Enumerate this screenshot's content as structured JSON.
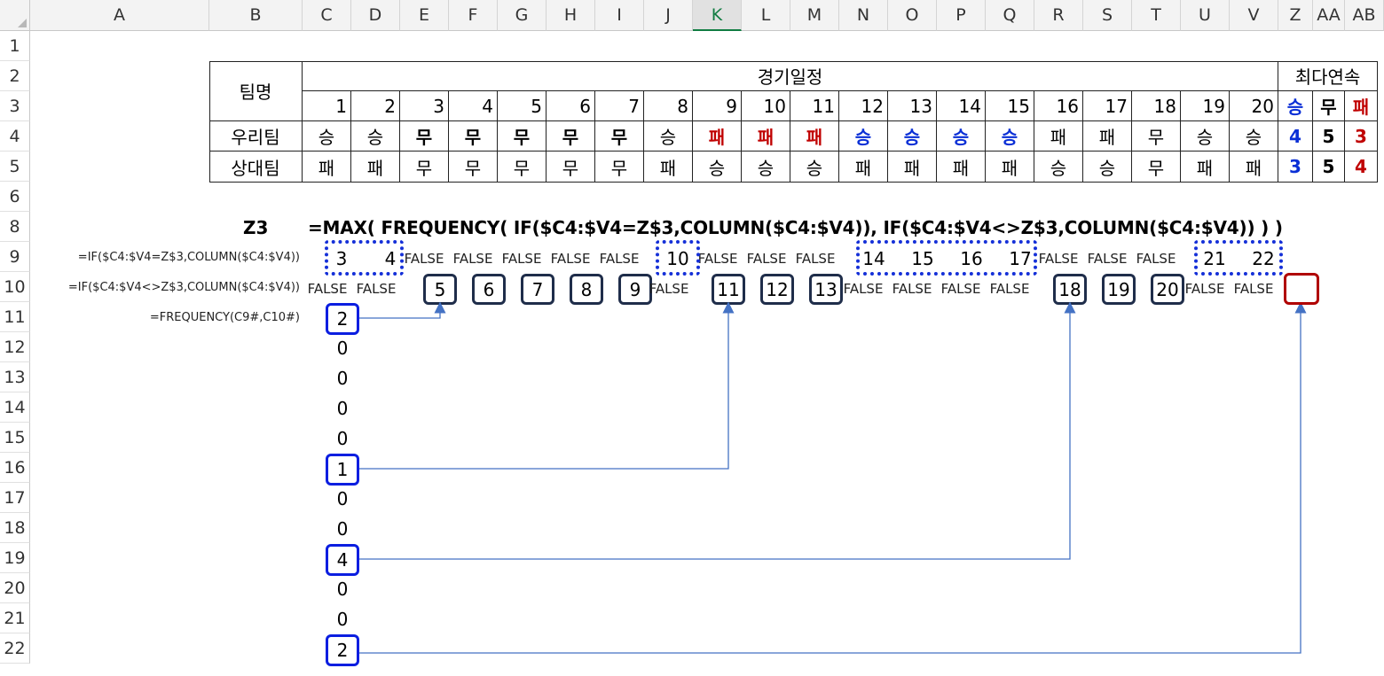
{
  "columns": [
    "A",
    "B",
    "C",
    "D",
    "E",
    "F",
    "G",
    "H",
    "I",
    "J",
    "K",
    "L",
    "M",
    "N",
    "O",
    "P",
    "Q",
    "R",
    "S",
    "T",
    "U",
    "V",
    "Z",
    "AA",
    "AB"
  ],
  "selected_column": "K",
  "rows": [
    "1",
    "2",
    "3",
    "4",
    "5",
    "6",
    "8",
    "9",
    "10",
    "11",
    "12",
    "13",
    "14",
    "15",
    "16",
    "17",
    "18",
    "19",
    "20",
    "21",
    "22"
  ],
  "table": {
    "team_header": "팀명",
    "schedule_header": "경기일정",
    "streak_header": "최다연속",
    "game_numbers": [
      "1",
      "2",
      "3",
      "4",
      "5",
      "6",
      "7",
      "8",
      "9",
      "10",
      "11",
      "12",
      "13",
      "14",
      "15",
      "16",
      "17",
      "18",
      "19",
      "20"
    ],
    "streak_labels": [
      "승",
      "무",
      "패"
    ],
    "our_team": "우리팀",
    "opp_team": "상대팀",
    "our_results": [
      "승",
      "승",
      "무",
      "무",
      "무",
      "무",
      "무",
      "승",
      "패",
      "패",
      "패",
      "승",
      "승",
      "승",
      "승",
      "패",
      "패",
      "무",
      "승",
      "승"
    ],
    "opp_results": [
      "패",
      "패",
      "무",
      "무",
      "무",
      "무",
      "무",
      "패",
      "승",
      "승",
      "승",
      "패",
      "패",
      "패",
      "패",
      "승",
      "승",
      "무",
      "패",
      "패"
    ],
    "our_streaks": [
      "4",
      "5",
      "3"
    ],
    "opp_streaks": [
      "3",
      "5",
      "4"
    ]
  },
  "formula_row": {
    "cell": "Z3",
    "formula": "=MAX( FREQUENCY( IF($C4:$V4=Z$3,COLUMN($C4:$V4)), IF($C4:$V4<>Z$3,COLUMN($C4:$V4)) ) )"
  },
  "row_labels": {
    "r9": "=IF($C4:$V4=Z$3,COLUMN($C4:$V4))",
    "r10": "=IF($C4:$V4<>Z$3,COLUMN($C4:$V4))",
    "r11": "=FREQUENCY(C9#,C10#)"
  },
  "row9": [
    "3",
    "4",
    "FALSE",
    "FALSE",
    "FALSE",
    "FALSE",
    "FALSE",
    "10",
    "FALSE",
    "FALSE",
    "FALSE",
    "14",
    "15",
    "16",
    "17",
    "FALSE",
    "FALSE",
    "FALSE",
    "21",
    "22"
  ],
  "row10": [
    "FALSE",
    "FALSE",
    "5",
    "6",
    "7",
    "8",
    "9",
    "FALSE",
    "11",
    "12",
    "13",
    "FALSE",
    "FALSE",
    "FALSE",
    "FALSE",
    "18",
    "19",
    "20",
    "FALSE",
    "FALSE"
  ],
  "frequency": [
    "2",
    "0",
    "0",
    "0",
    "0",
    "1",
    "0",
    "0",
    "4",
    "0",
    "0",
    "2"
  ],
  "colors": {
    "win_blue": "#0a2fd6",
    "loss_red": "#c00000",
    "box_navy": "#1f2d4a",
    "box_blue": "#0b1ee0",
    "arrow": "#4472c4"
  }
}
